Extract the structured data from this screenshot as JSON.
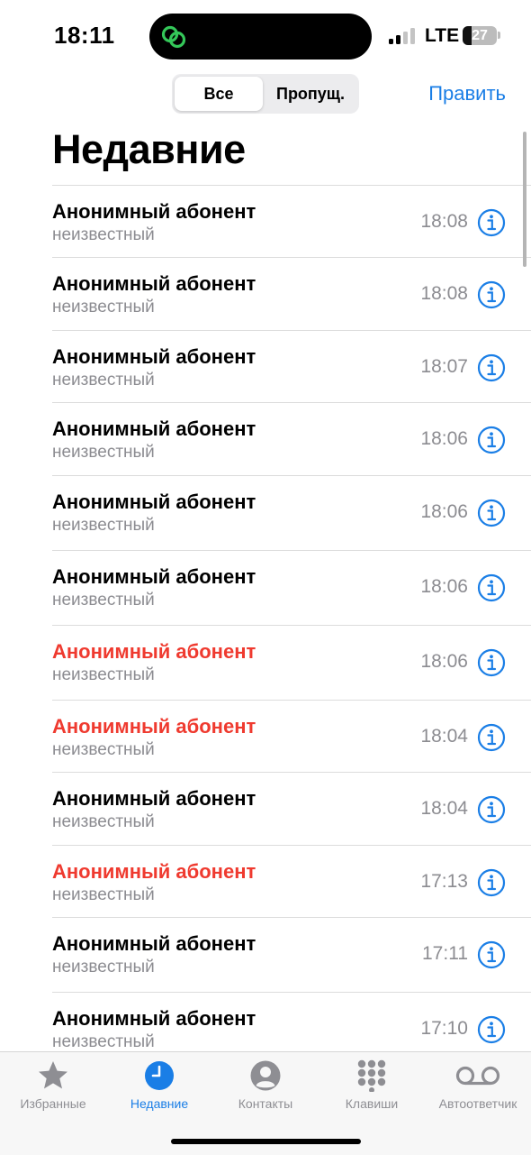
{
  "status_bar": {
    "time": "18:11",
    "network": "LTE",
    "battery": "27",
    "battery_fraction": 0.27
  },
  "segments": {
    "all": "Все",
    "missed": "Пропущ."
  },
  "edit_label": "Править",
  "title": "Недавние",
  "colors": {
    "accent": "#1a7ee6",
    "missed": "#ef3a2f",
    "secondary": "#8c8c91"
  },
  "calls": [
    {
      "name": "Анонимный абонент",
      "type": "неизвестный",
      "time": "18:08",
      "missed": false
    },
    {
      "name": "Анонимный абонент",
      "type": "неизвестный",
      "time": "18:08",
      "missed": false
    },
    {
      "name": "Анонимный абонент",
      "type": "неизвестный",
      "time": "18:07",
      "missed": false
    },
    {
      "name": "Анонимный абонент",
      "type": "неизвестный",
      "time": "18:06",
      "missed": false
    },
    {
      "name": "Анонимный абонент",
      "type": "неизвестный",
      "time": "18:06",
      "missed": false
    },
    {
      "name": "Анонимный абонент",
      "type": "неизвестный",
      "time": "18:06",
      "missed": false
    },
    {
      "name": "Анонимный абонент",
      "type": "неизвестный",
      "time": "18:06",
      "missed": true
    },
    {
      "name": "Анонимный абонент",
      "type": "неизвестный",
      "time": "18:04",
      "missed": true
    },
    {
      "name": "Анонимный абонент",
      "type": "неизвестный",
      "time": "18:04",
      "missed": false
    },
    {
      "name": "Анонимный абонент",
      "type": "неизвестный",
      "time": "17:13",
      "missed": true
    },
    {
      "name": "Анонимный абонент",
      "type": "неизвестный",
      "time": "17:11",
      "missed": false
    },
    {
      "name": "Анонимный абонент",
      "type": "неизвестный",
      "time": "17:10",
      "missed": false
    }
  ],
  "tabs": [
    {
      "label": "Избранные",
      "icon": "star-icon",
      "active": false
    },
    {
      "label": "Недавние",
      "icon": "clock-icon",
      "active": true
    },
    {
      "label": "Контакты",
      "icon": "person-icon",
      "active": false
    },
    {
      "label": "Клавиши",
      "icon": "keypad-icon",
      "active": false
    },
    {
      "label": "Автоответчик",
      "icon": "voicemail-icon",
      "active": false
    }
  ]
}
